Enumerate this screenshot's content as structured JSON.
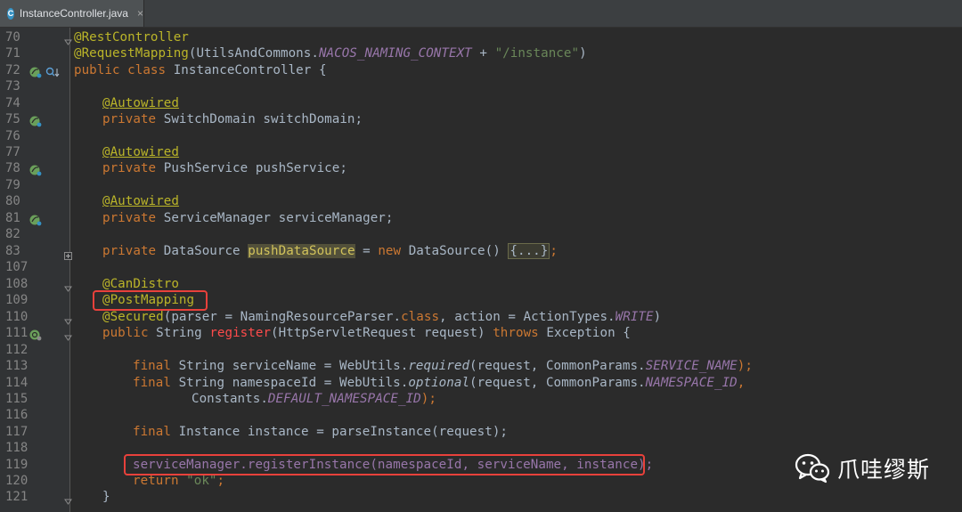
{
  "tab": {
    "icon_letter": "C",
    "label": "InstanceController.java",
    "close": "×"
  },
  "lines": [
    {
      "n": "70"
    },
    {
      "n": "71"
    },
    {
      "n": "72"
    },
    {
      "n": "73"
    },
    {
      "n": "74"
    },
    {
      "n": "75"
    },
    {
      "n": "76"
    },
    {
      "n": "77"
    },
    {
      "n": "78"
    },
    {
      "n": "79"
    },
    {
      "n": "80"
    },
    {
      "n": "81"
    },
    {
      "n": "82"
    },
    {
      "n": "83"
    },
    {
      "n": "107"
    },
    {
      "n": "108"
    },
    {
      "n": "109"
    },
    {
      "n": "110"
    },
    {
      "n": "111"
    },
    {
      "n": "112"
    },
    {
      "n": "113"
    },
    {
      "n": "114"
    },
    {
      "n": "115"
    },
    {
      "n": "116"
    },
    {
      "n": "117"
    },
    {
      "n": "118"
    },
    {
      "n": "119"
    },
    {
      "n": "120"
    },
    {
      "n": "121"
    }
  ],
  "code": {
    "l70": {
      "a": "@RestController"
    },
    "l71": {
      "a": "@RequestMapping",
      "b": "(UtilsAndCommons.",
      "c": "NACOS_NAMING_CONTEXT",
      "d": " + ",
      "e": "\"/instance\"",
      "f": ")"
    },
    "l72": {
      "a": "public class ",
      "b": "InstanceController {"
    },
    "l74": {
      "a": "@Autowired"
    },
    "l75": {
      "a": "private ",
      "b": "SwitchDomain switchDomain;"
    },
    "l77": {
      "a": "@Autowired"
    },
    "l78": {
      "a": "private ",
      "b": "PushService pushService;"
    },
    "l80": {
      "a": "@Autowired"
    },
    "l81": {
      "a": "private ",
      "b": "ServiceManager serviceManager;"
    },
    "l83": {
      "a": "private ",
      "b": "DataSource ",
      "c": "pushDataSource",
      "d": " = ",
      "e": "new ",
      "f": "DataSource() ",
      "g": "{...}",
      "h": ";"
    },
    "l108": {
      "a": "@CanDistro"
    },
    "l109": {
      "a": "@PostMapping"
    },
    "l110": {
      "a": "@Secured",
      "b": "(parser = NamingResourceParser.",
      "c": "class",
      "d": ", action = ActionTypes.",
      "e": "WRITE",
      "f": ")"
    },
    "l111": {
      "a": "public ",
      "b": "String ",
      "c": "register",
      "d": "(HttpServletRequest request) ",
      "e": "throws ",
      "f": "Exception {"
    },
    "l113": {
      "a": "final ",
      "b": "String serviceName = WebUtils.",
      "c": "required",
      "d": "(request, CommonParams.",
      "e": "SERVICE_NAME",
      "f": ");"
    },
    "l114": {
      "a": "final ",
      "b": "String namespaceId = WebUtils.",
      "c": "optional",
      "d": "(request, CommonParams.",
      "e": "NAMESPACE_ID",
      "f": ","
    },
    "l115": {
      "a": "Constants.",
      "b": "DEFAULT_NAMESPACE_ID",
      "c": ");"
    },
    "l117": {
      "a": "final ",
      "b": "Instance instance = parseInstance(request);"
    },
    "l119": {
      "a": "serviceManager.registerInstance(namespaceId, serviceName, instance);"
    },
    "l120": {
      "a": "return ",
      "b": "\"ok\"",
      "c": ";"
    },
    "l121": {
      "a": "}"
    }
  },
  "watermark": {
    "text": "爪哇缪斯",
    "icon": "wechat-icon"
  },
  "colors": {
    "highlight_box": "#e8413b",
    "keyword": "#cc7832",
    "annotation": "#bbb529",
    "string": "#6a8759",
    "field": "#9876aa"
  }
}
